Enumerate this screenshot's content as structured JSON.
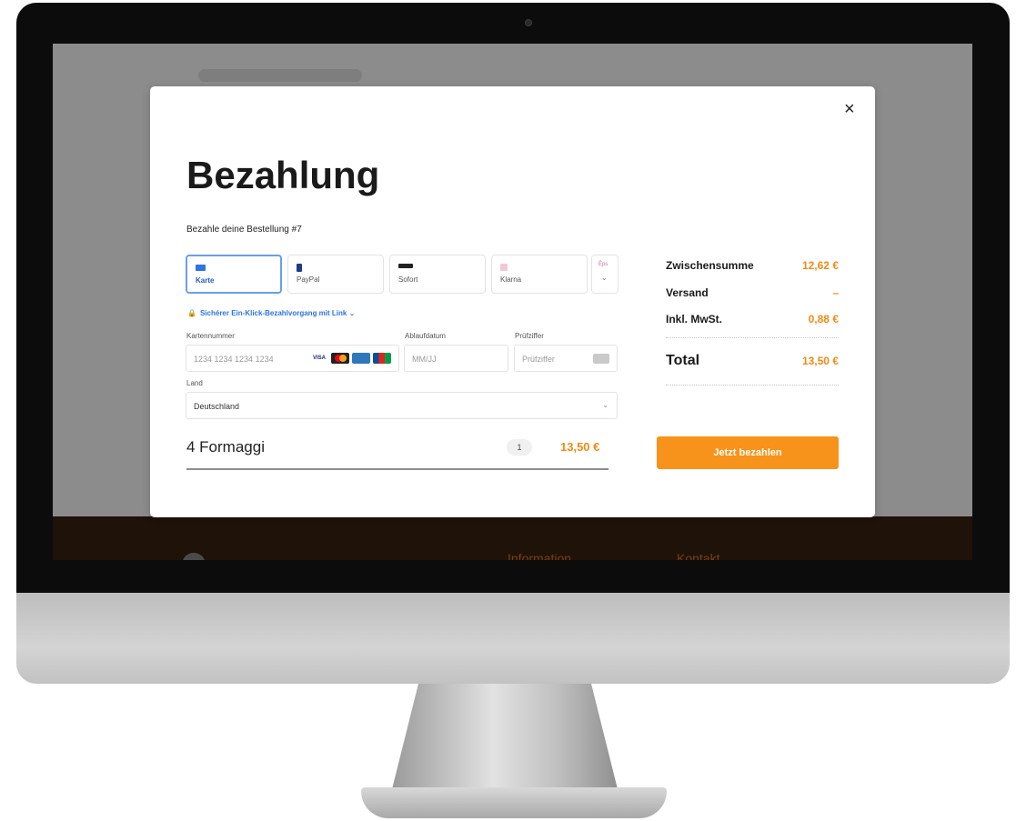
{
  "modal": {
    "title": "Bezahlung",
    "subtitle": "Bezahle deine Bestellung #7",
    "close_label": "×"
  },
  "payment_methods": [
    {
      "label": "Karte",
      "icon": "card-icon",
      "active": true,
      "color": "#2d74e6"
    },
    {
      "label": "PayPal",
      "icon": "paypal-icon",
      "active": false,
      "color": "#1f3a8a"
    },
    {
      "label": "Sofort",
      "icon": "sofort-icon",
      "active": false,
      "color": "#222222"
    },
    {
      "label": "Klarna",
      "icon": "klarna-icon",
      "active": false,
      "color": "#d66a9a"
    }
  ],
  "more_methods": {
    "mini_label": "Ēps",
    "chevron": "⌄"
  },
  "secure_link": "Sichérer Ein-Klick-Bezahlvorgang mit Link ⌄",
  "form": {
    "card_number": {
      "label": "Kartennummer",
      "placeholder": "1234 1234 1234 1234"
    },
    "expiry": {
      "label": "Ablaufdatum",
      "placeholder": "MM/JJ"
    },
    "cvc": {
      "label": "Prüfziffer",
      "placeholder": "Prüfziffer"
    },
    "country": {
      "label": "Land",
      "value": "Deutschland"
    },
    "card_brands": [
      "VISA",
      "mastercard",
      "amex",
      "JCB"
    ]
  },
  "item": {
    "name": "4 Formaggi",
    "quantity": "1",
    "price": "13,50 €"
  },
  "summary": {
    "subtotal_label": "Zwischensumme",
    "subtotal_value": "12,62 €",
    "shipping_label": "Versand",
    "shipping_value": "–",
    "tax_label": "Inkl. MwSt.",
    "tax_value": "0,88 €",
    "total_label": "Total",
    "total_value": "13,50 €"
  },
  "pay_button": "Jetzt bezahlen",
  "background_footer": {
    "info": "Information",
    "contact": "Kontakt"
  },
  "colors": {
    "accent": "#f7931a",
    "link": "#2d74e6",
    "active_border": "#6aa0e8"
  }
}
